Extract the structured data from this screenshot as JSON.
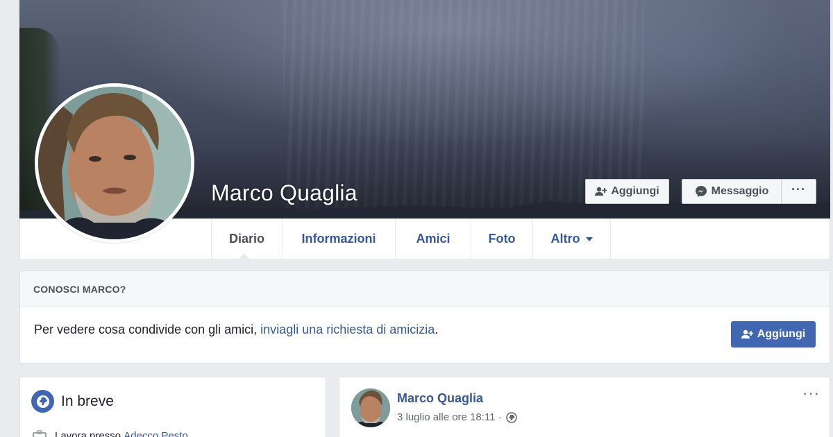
{
  "profile": {
    "name": "Marco Quaglia",
    "actions": {
      "add_label": "Aggiungi",
      "message_label": "Messaggio",
      "more_label": "···"
    }
  },
  "tabs": [
    {
      "label": "Diario",
      "active": true
    },
    {
      "label": "Informazioni",
      "active": false
    },
    {
      "label": "Amici",
      "active": false
    },
    {
      "label": "Foto",
      "active": false
    },
    {
      "label": "Altro",
      "active": false
    }
  ],
  "know": {
    "heading": "CONOSCI MARCO?",
    "text_before": "Per vedere cosa condivide con gli amici, ",
    "link": "inviagli una richiesta di amicizia",
    "text_after": ".",
    "button_label": "Aggiungi"
  },
  "intro": {
    "title": "In breve",
    "work_prefix": "Lavora presso ",
    "work_link": "Adecco Pesto"
  },
  "post": {
    "author": "Marco Quaglia",
    "date": "3 luglio alle ore 18:11 ·",
    "more": "···"
  },
  "colors": {
    "link": "#365899",
    "primary": "#4267b2",
    "page_bg": "#e9ebee",
    "border": "#dddfe2"
  },
  "icons": [
    "add-friend-icon",
    "messenger-icon",
    "globe-icon",
    "briefcase-icon",
    "dropdown-caret-icon"
  ]
}
